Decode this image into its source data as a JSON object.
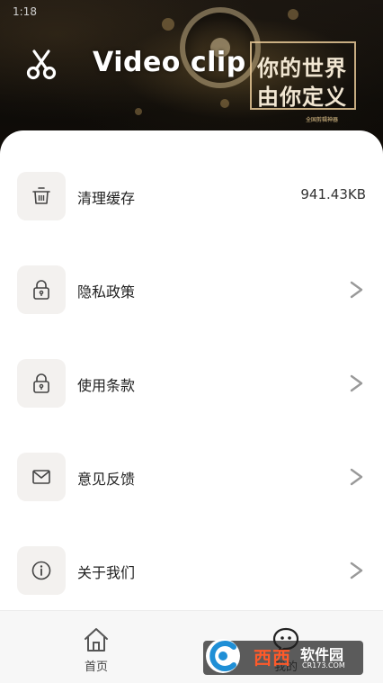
{
  "status_bar": {
    "time": "1:18"
  },
  "banner": {
    "app_title": "Video clip",
    "slogan_line1": "你的世界",
    "slogan_line2": "由你定义",
    "small_text": "全国剪辑神器"
  },
  "menu": {
    "items": [
      {
        "label": "清理缓存",
        "value": "941.43KB",
        "icon": "trash-basket-icon"
      },
      {
        "label": "隐私政策",
        "icon": "lock-icon",
        "chevron": "chevron-right-icon"
      },
      {
        "label": "使用条款",
        "icon": "lock-icon",
        "chevron": "chevron-right-icon"
      },
      {
        "label": "意见反馈",
        "icon": "mail-icon",
        "chevron": "chevron-right-icon"
      },
      {
        "label": "关于我们",
        "icon": "info-icon",
        "chevron": "chevron-right-icon"
      }
    ]
  },
  "bottom_nav": {
    "home_label": "首页",
    "mine_label": "我的"
  },
  "watermark": {
    "brand": "西西",
    "cn": "软件园",
    "url": "CR173.COM"
  },
  "colors": {
    "tile_bg": "#f3f1ef",
    "chevron": "#999999",
    "text": "#222222",
    "nav_bg": "#f7f7f7"
  }
}
